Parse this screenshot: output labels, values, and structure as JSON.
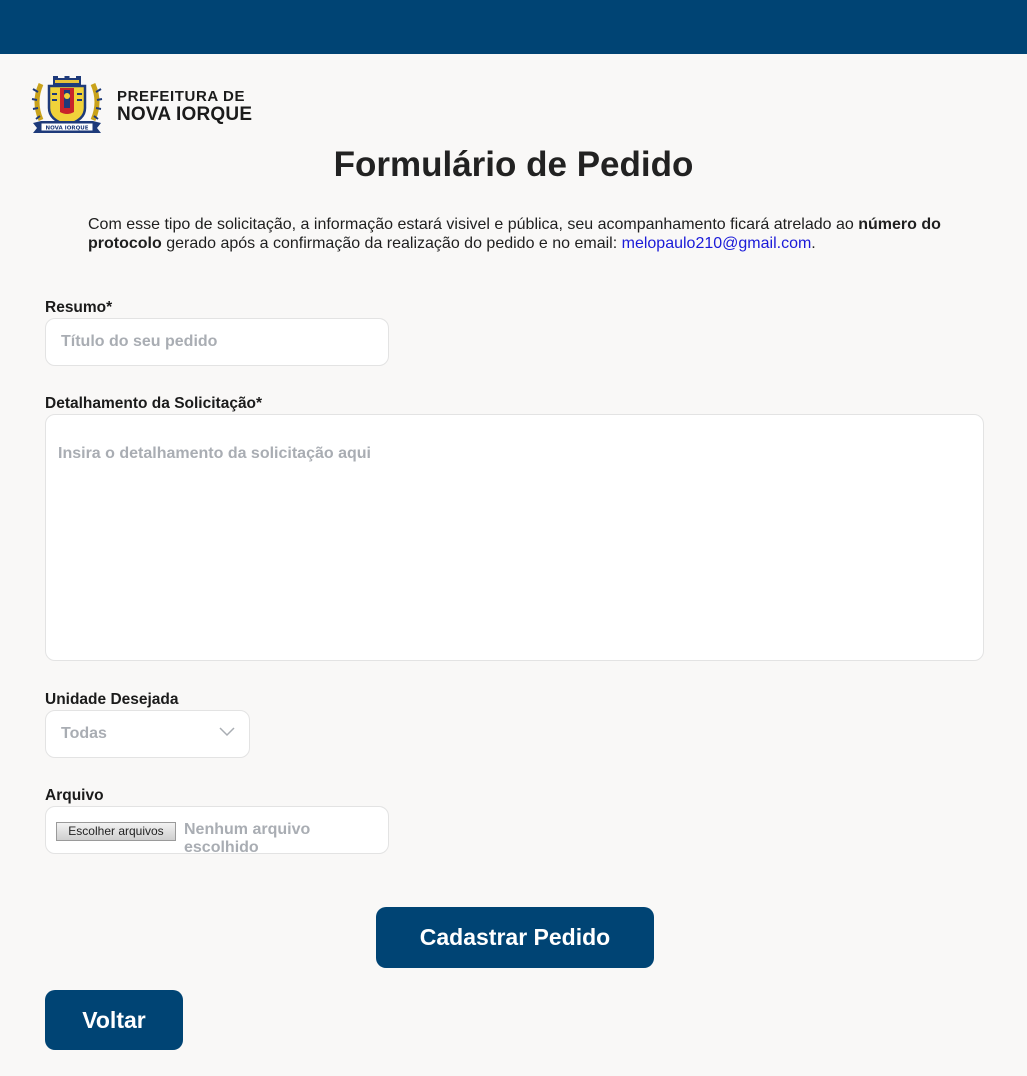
{
  "header": {
    "logo_line1": "PREFEITURA DE",
    "logo_line2": "NOVA IORQUE",
    "crest_ribbon": "NOVA IORQUE"
  },
  "page": {
    "title": "Formulário de Pedido",
    "intro_part1": "Com esse tipo de solicitação, a informação estará visivel e pública, seu acompanhamento ficará atrelado ao ",
    "intro_bold": "número do protocolo",
    "intro_part2": " gerado após a confirmação da realização do pedido e no email: ",
    "intro_email": "melopaulo210@gmail.com",
    "intro_end": "."
  },
  "form": {
    "resumo_label": "Resumo*",
    "resumo_placeholder": "Título do seu pedido",
    "detalhe_label": "Detalhamento da Solicitação*",
    "detalhe_placeholder": "Insira o detalhamento da solicitação aqui",
    "unidade_label": "Unidade Desejada",
    "unidade_value": "Todas",
    "arquivo_label": "Arquivo",
    "arquivo_button": "Escolher arquivos",
    "arquivo_status": "Nenhum arquivo escolhido"
  },
  "actions": {
    "submit": "Cadastrar Pedido",
    "back": "Voltar"
  },
  "colors": {
    "brand": "#004474",
    "background": "#f9f8f7",
    "link": "#1a1ad8",
    "placeholder": "#a9adb3"
  },
  "icons": {
    "crest": "city-crest-icon",
    "select": "chevron-down-icon"
  }
}
